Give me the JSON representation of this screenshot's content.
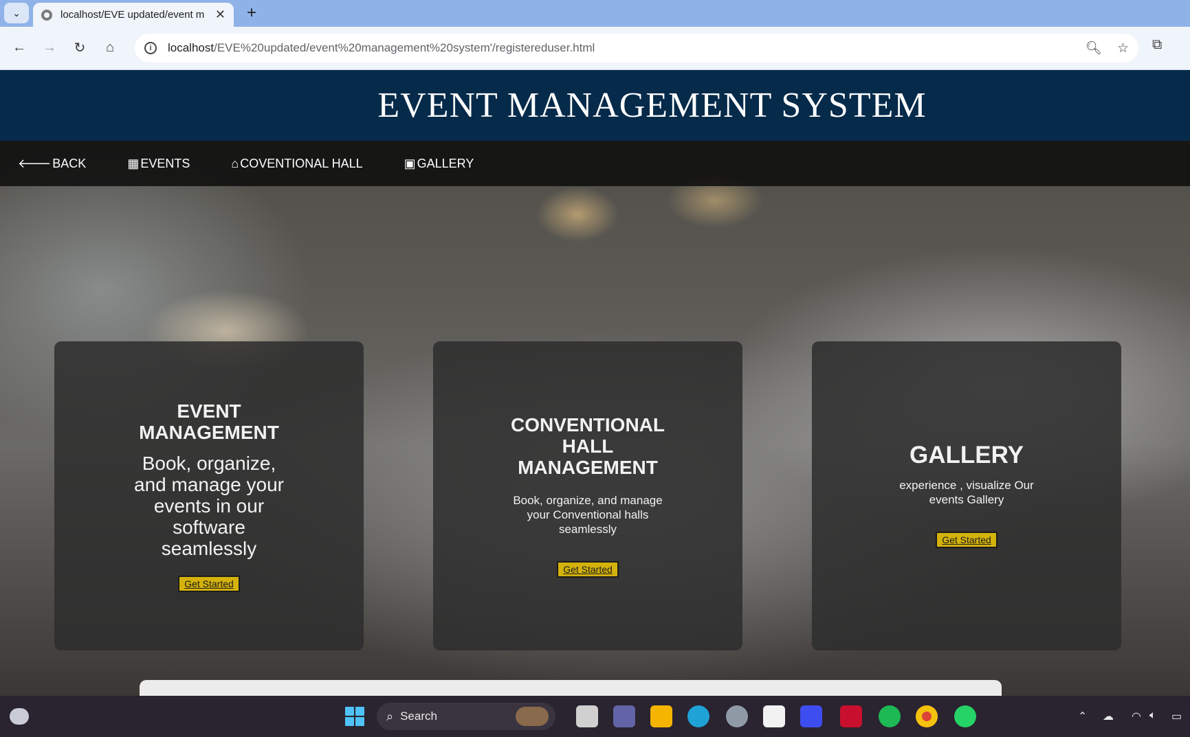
{
  "browser": {
    "tab_title": "localhost/EVE updated/event m",
    "tab_close": "✕",
    "new_tab": "+",
    "url_host": "localhost",
    "url_path": "/EVE%20updated/event%20management%20system'/registereduser.html"
  },
  "site": {
    "title": "EVENT MANAGEMENT SYSTEM",
    "nav": [
      {
        "icon": "arrow-left-icon",
        "glyph": "🡐",
        "label": "BACK"
      },
      {
        "icon": "calendar-icon",
        "glyph": "▦",
        "label": "EVENTS"
      },
      {
        "icon": "hall-icon",
        "glyph": "⌂",
        "label": "COVENTIONAL HALL"
      },
      {
        "icon": "image-icon",
        "glyph": "▣",
        "label": "GALLERY"
      }
    ]
  },
  "cards": [
    {
      "title": "EVENT MANAGEMENT",
      "description": "Book, organize, and manage your events in our software seamlessly",
      "button": "Get Started"
    },
    {
      "title": "CONVENTIONAL HALL MANAGEMENT",
      "description": "Book, organize, and manage your Conventional halls seamlessly",
      "button": "Get Started"
    },
    {
      "title": "GALLERY",
      "description": "experience , visualize Our events Gallery",
      "button": "Get Started"
    }
  ],
  "taskbar": {
    "search_label": "Search"
  },
  "colors": {
    "header_bg": "#062a4a",
    "button_bg": "#d4b20c",
    "card_bg": "rgba(45,45,45,0.86)"
  }
}
